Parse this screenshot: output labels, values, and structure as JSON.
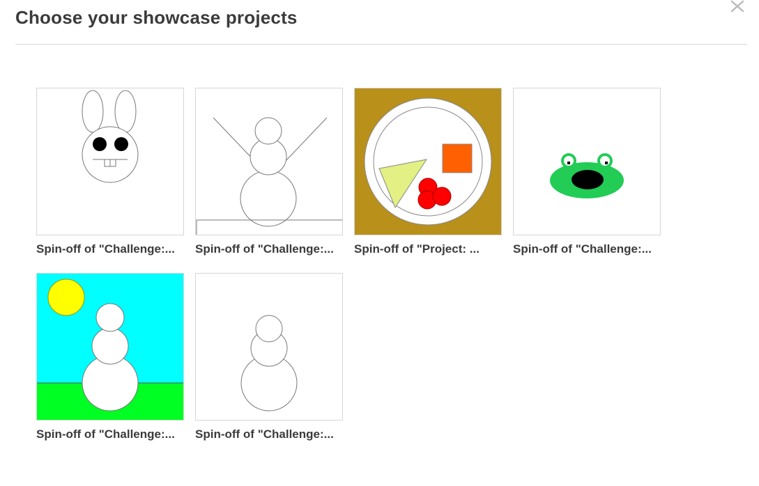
{
  "dialog": {
    "title": "Choose your showcase projects",
    "close_icon": "close-icon"
  },
  "projects": [
    {
      "title": "Spin-off of \"Challenge:..."
    },
    {
      "title": "Spin-off of \"Challenge:..."
    },
    {
      "title": "Spin-off of \"Project: ..."
    },
    {
      "title": "Spin-off of \"Challenge:..."
    },
    {
      "title": "Spin-off of \"Challenge:..."
    },
    {
      "title": "Spin-off of \"Challenge:..."
    }
  ],
  "colors": {
    "border": "#d6d6d6",
    "text": "#3b3b3b",
    "plate_bg": "#b8901a",
    "sky": "#00ffff",
    "grass": "#00ff22",
    "sun": "#ffff00",
    "frog": "#22cc55"
  }
}
